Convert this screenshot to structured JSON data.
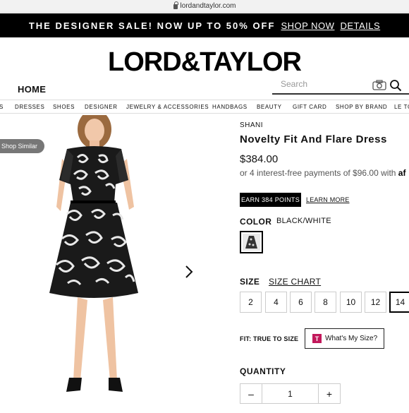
{
  "browser": {
    "url": "lordandtaylor.com"
  },
  "promo": {
    "text": "THE DESIGNER SALE! NOW UP TO 50% OFF",
    "shop_now": "SHOP NOW",
    "details": "DETAILS"
  },
  "header": {
    "logo": "LORD&TAYLOR",
    "home": "HOME",
    "search_placeholder": "Search"
  },
  "categories": [
    "S",
    "DRESSES",
    "SHOES",
    "DESIGNER",
    "JEWELRY & ACCESSORIES",
    "HANDBAGS",
    "BEAUTY",
    "GIFT CARD",
    "SHOP BY BRAND",
    "LE TO"
  ],
  "image": {
    "shop_similar": "Shop Similar"
  },
  "product": {
    "brand": "SHANI",
    "name": "Novelty Fit And Flare Dress",
    "price": "$384.00",
    "installments": "or 4 interest-free payments of $96.00 with",
    "installments_brand": "af",
    "points": "EARN 384 POINTS",
    "learn_more": "LEARN MORE",
    "color_label": "COLOR",
    "color_value": "BLACK/WHITE",
    "size_label": "SIZE",
    "size_chart": "SIZE CHART",
    "sizes": [
      "2",
      "4",
      "6",
      "8",
      "10",
      "12",
      "14"
    ],
    "selected_size": "14",
    "fit_label": "FIT: TRUE TO SIZE",
    "fit_button": "What's My Size?",
    "fit_icon_letter": "T",
    "quantity_label": "QUANTITY",
    "quantity_minus": "–",
    "quantity_value": "1",
    "quantity_plus": "+"
  }
}
